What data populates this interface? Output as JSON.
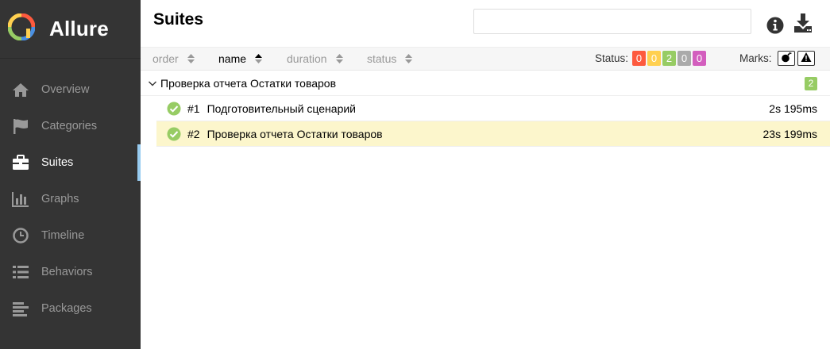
{
  "app": {
    "title": "Allure"
  },
  "sidebar": {
    "items": [
      {
        "label": "Overview",
        "icon": "home-icon",
        "active": false
      },
      {
        "label": "Categories",
        "icon": "flag-icon",
        "active": false
      },
      {
        "label": "Suites",
        "icon": "briefcase-icon",
        "active": true
      },
      {
        "label": "Graphs",
        "icon": "bar-chart-icon",
        "active": false
      },
      {
        "label": "Timeline",
        "icon": "clock-icon",
        "active": false
      },
      {
        "label": "Behaviors",
        "icon": "list-icon",
        "active": false
      },
      {
        "label": "Packages",
        "icon": "align-left-icon",
        "active": false
      }
    ],
    "active_indicator_color": "#97cbf0"
  },
  "header": {
    "title": "Suites",
    "search": {
      "value": "",
      "placeholder": ""
    },
    "icons": [
      "info-icon",
      "download-icon"
    ]
  },
  "toolbar": {
    "sorters": {
      "order": "order",
      "name": "name",
      "duration": "duration",
      "status": "status",
      "active": "name"
    },
    "status_label": "Status:",
    "status_counts": [
      {
        "value": "0",
        "status": "failed",
        "color": "#fd5a3e"
      },
      {
        "value": "0",
        "status": "broken",
        "color": "#ffd050"
      },
      {
        "value": "2",
        "status": "passed",
        "color": "#97cc64"
      },
      {
        "value": "0",
        "status": "skipped",
        "color": "#aaaaaa"
      },
      {
        "value": "0",
        "status": "unknown",
        "color": "#d35ebe"
      }
    ],
    "marks_label": "Marks:",
    "marks": [
      "bomb-icon",
      "warning-icon"
    ]
  },
  "tree": {
    "group": {
      "name": "Проверка отчета Остатки товаров",
      "count": "2",
      "count_color": "#97cc64",
      "expanded": true
    },
    "tests": [
      {
        "order": "#1",
        "name": "Подготовительный сценарий",
        "duration": "2s 195ms",
        "status": "passed",
        "selected": false
      },
      {
        "order": "#2",
        "name": "Проверка отчета Остатки товаров",
        "duration": "23s 199ms",
        "status": "passed",
        "selected": true
      }
    ]
  },
  "colors": {
    "sidebar_bg": "#343434",
    "passed": "#97cc64",
    "selected_row": "#fcf6cc"
  }
}
